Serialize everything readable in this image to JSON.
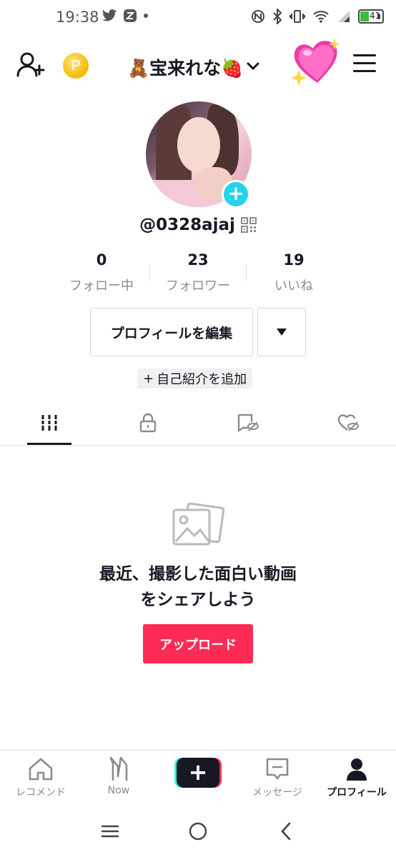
{
  "status_bar": {
    "time": "19:38",
    "battery_level": "41",
    "icons": [
      "twitter-icon",
      "z-app-icon",
      "dot-icon",
      "nfc-icon",
      "bluetooth-icon",
      "vibrate-icon",
      "wifi-icon",
      "signal-icon",
      "battery-icon"
    ]
  },
  "header": {
    "username": "🧸宝来れな🍓",
    "icons": [
      "add-user-icon",
      "coin-icon",
      "chevron-down-icon",
      "hearts-sticker",
      "menu-icon"
    ],
    "coin_letter": "P"
  },
  "profile": {
    "handle": "@0328ajaj",
    "stats": [
      {
        "value": "0",
        "label": "フォロー中"
      },
      {
        "value": "23",
        "label": "フォロワー"
      },
      {
        "value": "19",
        "label": "いいね"
      }
    ],
    "edit_profile_label": "プロフィールを編集",
    "add_bio_plus": "+",
    "add_bio_label": "自己紹介を追加"
  },
  "tabs": [
    "videos-grid-icon",
    "lock-icon",
    "tagged-hidden-icon",
    "liked-hidden-icon"
  ],
  "empty_state": {
    "title_line1": "最近、撮影した面白い動画",
    "title_line2": "をシェアしよう",
    "upload_label": "アップロード"
  },
  "bottom_nav": {
    "items": [
      {
        "label": "レコメンド",
        "icon": "home-icon"
      },
      {
        "label": "Now",
        "icon": "now-icon"
      },
      {
        "label": "",
        "icon": "create-plus-icon",
        "glyph": "+"
      },
      {
        "label": "メッセージ",
        "icon": "message-icon"
      },
      {
        "label": "プロフィール",
        "icon": "profile-icon"
      }
    ]
  },
  "colors": {
    "accent": "#fe2c55",
    "cyan": "#25f4ee",
    "avatar_plus": "#20d5ec",
    "text": "#161823",
    "muted": "#8a8b91"
  }
}
